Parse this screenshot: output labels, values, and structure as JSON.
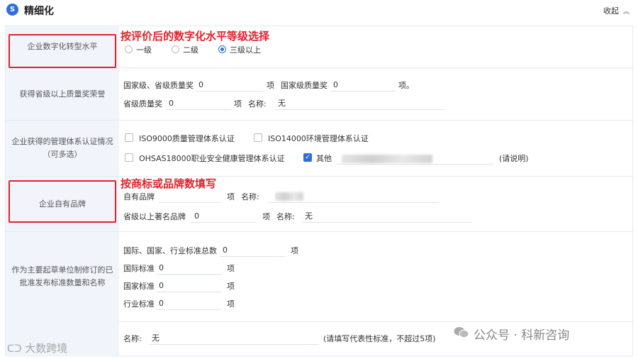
{
  "header": {
    "logo": "S",
    "title": "精细化",
    "collapse_label": "收起",
    "collapse_icon": "chevron-up-icon"
  },
  "rows": {
    "digital": {
      "label": "企业数字化转型水平",
      "options": [
        "一级",
        "二级",
        "三级以上"
      ],
      "selected": "三级以上"
    },
    "quality": {
      "label": "获得省级以上质量奖荣誉",
      "national_provincial_label": "国家级、省级质量奖",
      "national_provincial_value": "0",
      "unit": "项",
      "national_label": "国家级质量奖",
      "national_value": "0",
      "unit_end": "项。",
      "provincial_label": "省级质量奖",
      "provincial_value": "0",
      "provincial_unit": "项",
      "name_label": "名称:",
      "name_value": "无"
    },
    "mgmt": {
      "label": "企业获得的管理体系认证情况（可多选）",
      "iso9000": "ISO9000质量管理体系认证",
      "iso14000": "ISO14000环境管理体系认证",
      "ohsas": "OHSAS18000职业安全健康管理体系认证",
      "other": "其他",
      "other_checked": true,
      "note": "(请说明)"
    },
    "brand": {
      "label": "企业自有品牌",
      "own_label": "自有品牌",
      "own_unit": "项",
      "own_name_label": "名称:",
      "famous_label": "省级以上著名品牌",
      "famous_value": "0",
      "famous_unit": "项",
      "famous_name_label": "名称:",
      "famous_name_value": "无"
    },
    "standard": {
      "label": "作为主要起草单位制修订的已批准发布标准数量和名称",
      "total_label": "国际、国家、行业标准总数",
      "total_value": "0",
      "total_unit": "项",
      "intl_label": "国际标准",
      "intl_value": "0",
      "intl_unit": "项",
      "nat_label": "国家标准",
      "nat_value": "0",
      "nat_unit": "项",
      "ind_label": "行业标准",
      "ind_value": "0",
      "ind_unit": "项",
      "name_label": "名称:",
      "name_value": "无",
      "hint": "(请填写代表性标准，不超过5项)"
    }
  },
  "annotations": {
    "digital_hint": "按评价后的数字化水平等级选择",
    "brand_hint": "按商标或品牌数填写"
  },
  "watermarks": {
    "wechat": "公众号 · 科新咨询",
    "left": "大数跨境"
  },
  "colors": {
    "accent": "#2f6fd6",
    "annotation": "#e0222b",
    "label_bg": "#f1f5fb"
  }
}
